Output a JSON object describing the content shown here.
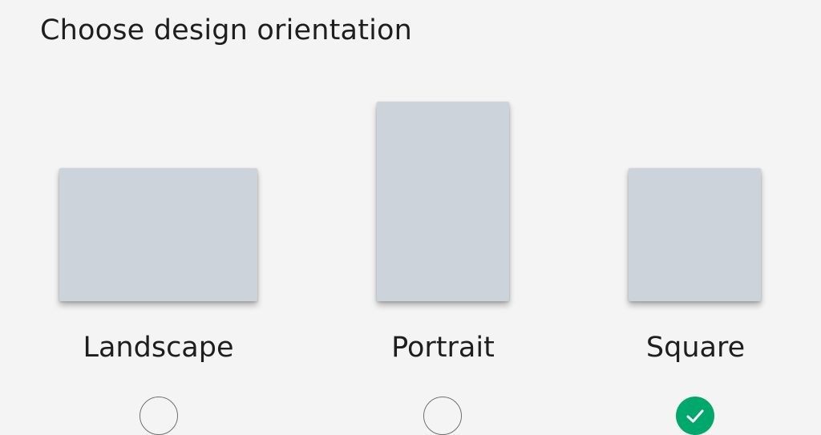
{
  "title": "Choose design orientation",
  "options": [
    {
      "label": "Landscape",
      "selected": false,
      "icon": "radio-unchecked-icon"
    },
    {
      "label": "Portrait",
      "selected": false,
      "icon": "radio-unchecked-icon"
    },
    {
      "label": "Square",
      "selected": true,
      "icon": "radio-checked-icon"
    }
  ],
  "colors": {
    "background": "#f4f4f4",
    "preview": "#ccd3db",
    "selected": "#00a86b",
    "text": "#1e1e1e"
  }
}
